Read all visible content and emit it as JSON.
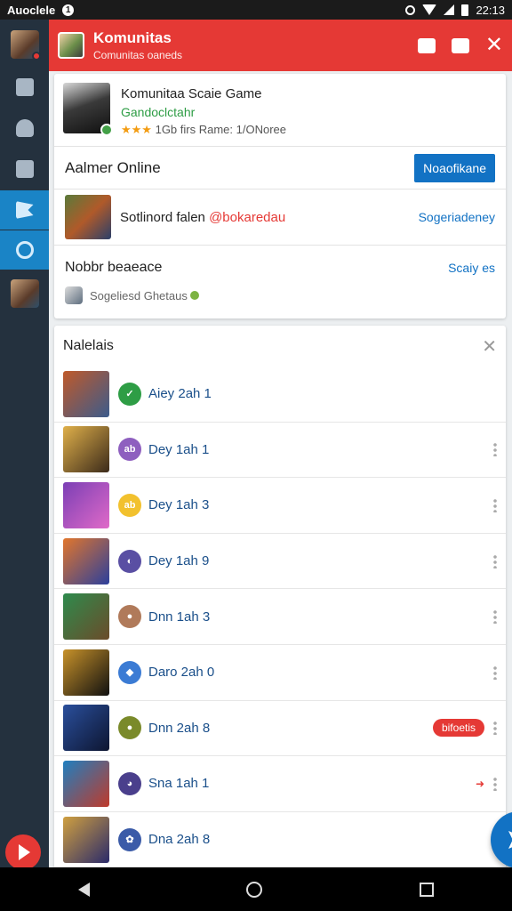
{
  "status_bar": {
    "carrier": "Auoclele",
    "notification_count": "1",
    "time": "22:13"
  },
  "header": {
    "title": "Komunitas",
    "subtitle": "Comunitas oaneds"
  },
  "game_card": {
    "title": "Komunitaa Scaie Game",
    "developer": "Gandoclctahr",
    "stars": "★★★",
    "rating_text": "1Gb firs",
    "meta_text": "Rame: 1/ONoree"
  },
  "online": {
    "label": "Aalmer Online",
    "button_label": "Noaofikane"
  },
  "sotl": {
    "text": "Sotlinord falen",
    "tag": "@bokaredau",
    "link": "Sogeriadeney"
  },
  "mobile": {
    "label": "Nobbr beaeace",
    "link": "Scaiy es",
    "sub": "Sogeliesd Ghetaus"
  },
  "list": {
    "title": "Nalelais",
    "items": [
      {
        "label": "Aiey 2ah 1",
        "icon_color": "#2e9d45",
        "icon_text": "✓",
        "thumb": [
          "#c05a2a",
          "#3b5b8c"
        ]
      },
      {
        "label": "Dey 1ah 1",
        "icon_color": "#8e5fbf",
        "icon_text": "ab",
        "thumb": [
          "#e0b04a",
          "#3b2a1a"
        ]
      },
      {
        "label": "Dey 1ah 3",
        "icon_color": "#f2c12e",
        "icon_text": "ab",
        "thumb": [
          "#7b3fb5",
          "#e06ac8"
        ]
      },
      {
        "label": "Dey 1ah 9",
        "icon_color": "#5a4fa3",
        "icon_text": "◐",
        "thumb": [
          "#e2762c",
          "#2b3f9c"
        ]
      },
      {
        "label": "Dnn 1ah 3",
        "icon_color": "#b07a5a",
        "icon_text": "●",
        "thumb": [
          "#2e8b4d",
          "#6b4b2a"
        ]
      },
      {
        "label": "Daro 2ah 0",
        "icon_color": "#3b7bd4",
        "icon_text": "◆",
        "thumb": [
          "#c8922a",
          "#101010"
        ]
      },
      {
        "label": "Dnn 2ah 8",
        "icon_color": "#7a8a2a",
        "icon_text": "●",
        "thumb": [
          "#2a4f9c",
          "#0d1530"
        ],
        "pill": "bifoetis"
      },
      {
        "label": "Sna 1ah 1",
        "icon_color": "#4a3f8c",
        "icon_text": "◕",
        "thumb": [
          "#1f7fc0",
          "#c03a2a"
        ],
        "arrow": "➜"
      },
      {
        "label": "Dna 2ah 8",
        "icon_color": "#3b5ba8",
        "icon_text": "✿",
        "thumb": [
          "#d0a040",
          "#2a2a6a"
        ]
      }
    ]
  },
  "colors": {
    "header_red": "#e53935",
    "accent_blue": "#1272c4",
    "sidebar_bg": "#24313e"
  },
  "icons": [
    "wifi-icon",
    "signal-icon",
    "battery-icon",
    "alarm-icon",
    "gallery-icon",
    "share-icon",
    "close-icon",
    "play-icon",
    "flag-icon",
    "clock-icon",
    "back-icon",
    "home-icon",
    "recents-icon"
  ]
}
